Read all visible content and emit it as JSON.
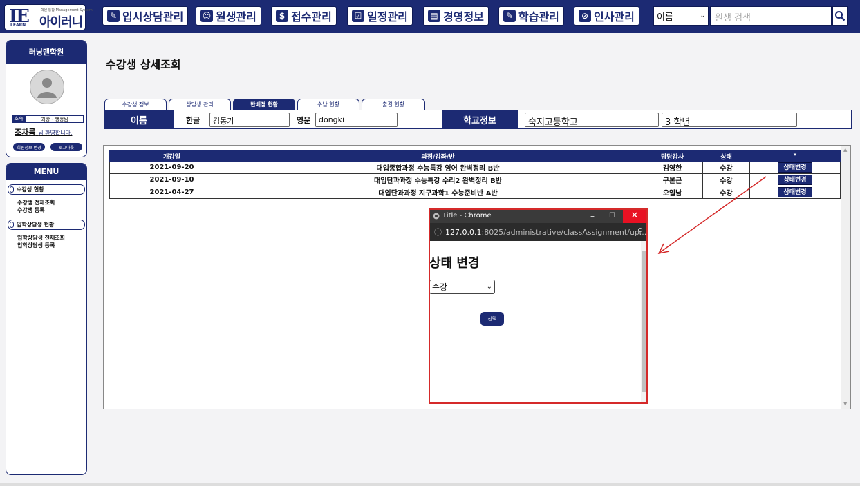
{
  "header": {
    "logo_mark": "IE",
    "logo_learn": "LEARN",
    "logo_sub": "학원 통합 Management System",
    "logo_name": "아이러니",
    "nav": [
      {
        "label": "입시상담관리",
        "icon": "✎"
      },
      {
        "label": "원생관리",
        "icon": "☺"
      },
      {
        "label": "접수관리",
        "icon": "$"
      },
      {
        "label": "일정관리",
        "icon": "☑"
      },
      {
        "label": "경영정보",
        "icon": "▤"
      },
      {
        "label": "학습관리",
        "icon": "✎"
      },
      {
        "label": "인사관리",
        "icon": "⊘"
      }
    ],
    "search_select": "이름",
    "search_placeholder": "원생 검색"
  },
  "sidebar": {
    "academy": "러닝맨학원",
    "info_key": "소속",
    "info_val": "과장 - 행정팀",
    "user_name": "조차름",
    "welcome": "님 환영합니다.",
    "btn_edit": "회원정보 변경",
    "btn_logout": "로그아웃",
    "menu_title": "MENU",
    "groups": [
      {
        "label": "수강생 현황",
        "items": [
          "수강생 전체조회",
          "수강생 등록"
        ]
      },
      {
        "label": "입학상담생 현황",
        "items": [
          "입학상담생 전체조회",
          "입학상담생 등록"
        ]
      }
    ]
  },
  "main": {
    "title": "수강생 상세조회",
    "tabs": [
      {
        "label": "수강생 정보",
        "active": false
      },
      {
        "label": "상담생 관리",
        "active": false
      },
      {
        "label": "반배정 현황",
        "active": true
      },
      {
        "label": "수납 현황",
        "active": false
      },
      {
        "label": "출결 현황",
        "active": false
      }
    ],
    "info": {
      "name_label": "이름",
      "korean_label": "한글",
      "korean_value": "김동기",
      "english_label": "영문",
      "english_value": "dongki",
      "school_label": "학교정보",
      "school_value": "숙지고등학교",
      "grade_value": "3 학년"
    },
    "table": {
      "headers": [
        "개강일",
        "과정/강좌/반",
        "담당강사",
        "상태",
        "*"
      ],
      "rows": [
        {
          "date": "2021-09-20",
          "course": "대입종합과정 수능특강 영어 완벽정리 B반",
          "teacher": "김영한",
          "status": "수강",
          "action": "상태변경"
        },
        {
          "date": "2021-09-10",
          "course": "대입단과과정 수능특강 수리2 완벽정리 B반",
          "teacher": "구본근",
          "status": "수강",
          "action": "상태변경"
        },
        {
          "date": "2021-04-27",
          "course": "대입단과과정 지구과학1 수능준비반 A반",
          "teacher": "오일남",
          "status": "수강",
          "action": "상태변경"
        }
      ]
    }
  },
  "popup": {
    "window_title": "Title - Chrome",
    "url_host": "127.0.0.1",
    "url_rest": ":8025/administrative/classAssignment/up...",
    "heading": "상태 변경",
    "select_value": "수강",
    "submit": "선택"
  },
  "colors": {
    "brand": "#1c2a73",
    "highlight": "#d52a2a"
  }
}
